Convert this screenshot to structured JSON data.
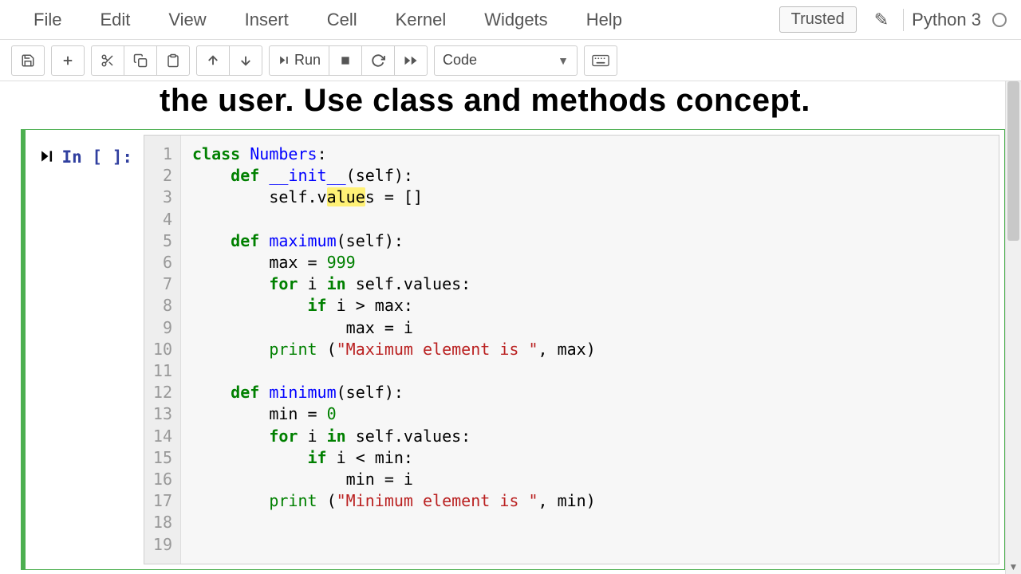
{
  "menubar": {
    "items": [
      "File",
      "Edit",
      "View",
      "Insert",
      "Cell",
      "Kernel",
      "Widgets",
      "Help"
    ]
  },
  "header": {
    "trusted_label": "Trusted",
    "kernel_name": "Python 3"
  },
  "toolbar": {
    "run_label": "Run",
    "cell_type_selected": "Code"
  },
  "heading_fragment": "the user. Use class and methods concept.",
  "cell": {
    "prompt": "In [ ]:",
    "line_numbers": [
      "1",
      "2",
      "3",
      "4",
      "5",
      "6",
      "7",
      "8",
      "9",
      "10",
      "11",
      "12",
      "13",
      "14",
      "15",
      "16",
      "17",
      "18",
      "19"
    ],
    "code": {
      "l1": {
        "kw": "class",
        "name": "Numbers",
        "tail": ":"
      },
      "l2": {
        "kw": "def",
        "name": "__init__",
        "args": "(self):"
      },
      "l3": {
        "pre": "self.v",
        "hl": "alue",
        "post": "s",
        "tail": " = []"
      },
      "l5": {
        "kw": "def",
        "name": "maximum",
        "args": "(self):"
      },
      "l6": {
        "assign": "max = ",
        "num": "999"
      },
      "l7": {
        "kw1": "for",
        "mid": " i ",
        "kw2": "in",
        "tail": " self.values:"
      },
      "l8": {
        "kw": "if",
        "body": " i > max:"
      },
      "l9": {
        "body": "max = i"
      },
      "l10": {
        "fn": "print",
        "open": " (",
        "str": "\"Maximum element is \"",
        "close": ", max)"
      },
      "l12": {
        "kw": "def",
        "name": "minimum",
        "args": "(self):"
      },
      "l13": {
        "assign": "min = ",
        "num": "0"
      },
      "l14": {
        "kw1": "for",
        "mid": " i ",
        "kw2": "in",
        "tail": " self.values:"
      },
      "l15": {
        "kw": "if",
        "body": " i < min:"
      },
      "l16": {
        "body": "min = i"
      },
      "l17": {
        "fn": "print",
        "open": " (",
        "str": "\"Minimum element is \"",
        "close": ", min)"
      }
    }
  }
}
